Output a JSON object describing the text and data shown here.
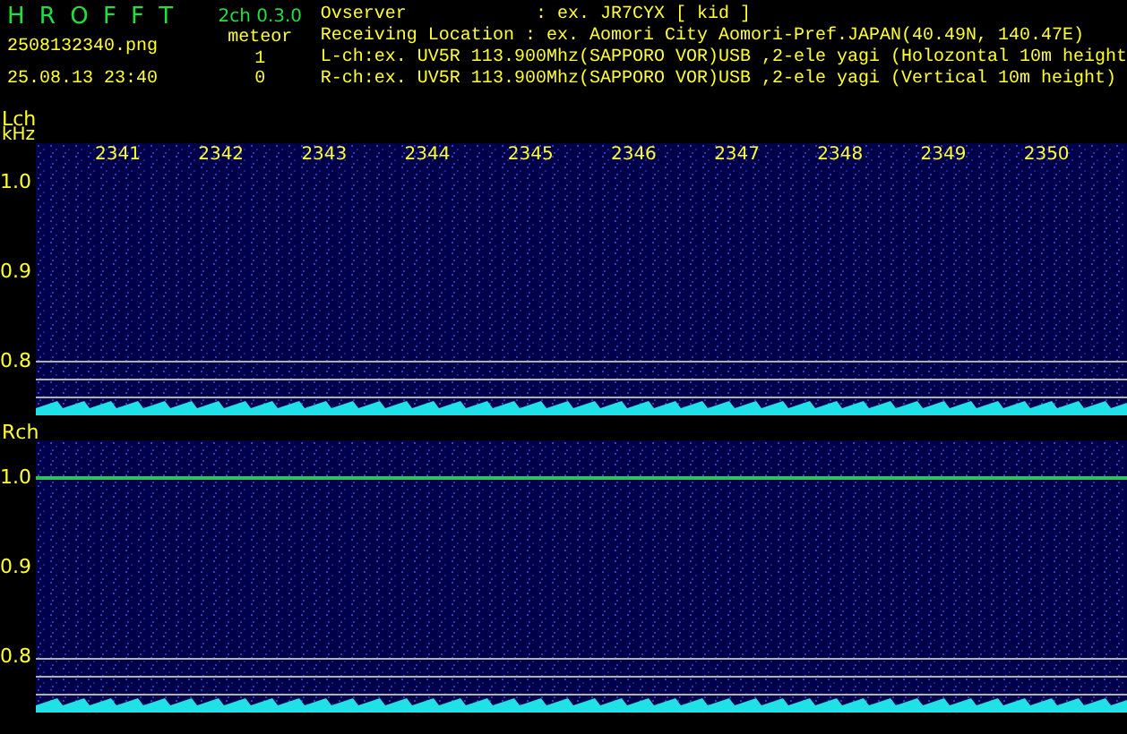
{
  "app": {
    "title": "H R O F F T",
    "version": "2ch 0.3.0",
    "file": "2508132340.png",
    "timestamp": "25.08.13 23:40"
  },
  "meteor": {
    "label": "meteor",
    "counts": [
      "1",
      "0"
    ]
  },
  "info": [
    "Ovserver            : ex. JR7CYX [ kid ]",
    "Receiving Location : ex. Aomori City Aomori-Pref.JAPAN(40.49N, 140.47E)",
    "L-ch:ex. UV5R 113.900Mhz(SAPPORO VOR)USB ,2-ele yagi (Holozontal 10m height",
    "R-ch:ex. UV5R 113.900Mhz(SAPPORO VOR)USB ,2-ele yagi (Vertical 10m height)"
  ],
  "channels": [
    {
      "label": "Lch",
      "unit": "kHz",
      "time_labels": [
        "2341",
        "2342",
        "2343",
        "2344",
        "2345",
        "2346",
        "2347",
        "2348",
        "2349",
        "2350"
      ],
      "y_labels": [
        "1.0",
        "0.9",
        "0.8"
      ],
      "echo_line": false
    },
    {
      "label": "Rch",
      "y_labels": [
        "1.0",
        "0.9",
        "0.8"
      ],
      "echo_line": true
    }
  ]
}
